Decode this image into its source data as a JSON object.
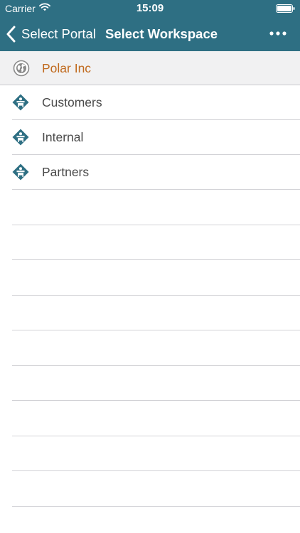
{
  "status_bar": {
    "carrier": "Carrier",
    "time": "15:09"
  },
  "nav": {
    "back_label": "Select Portal",
    "title": "Select Workspace",
    "more_icon": "ellipsis-icon"
  },
  "portal": {
    "label": "Polar Inc",
    "icon": "globe-icon"
  },
  "workspaces": [
    {
      "label": "Customers",
      "icon": "workspace-icon"
    },
    {
      "label": "Internal",
      "icon": "workspace-icon"
    },
    {
      "label": "Partners",
      "icon": "workspace-icon"
    }
  ],
  "colors": {
    "header_bg": "#2e6f83",
    "portal_text": "#c06a1e",
    "workspace_icon": "#2e6f83",
    "row_text": "#4a4a4a",
    "separator": "#d2d2d6"
  }
}
